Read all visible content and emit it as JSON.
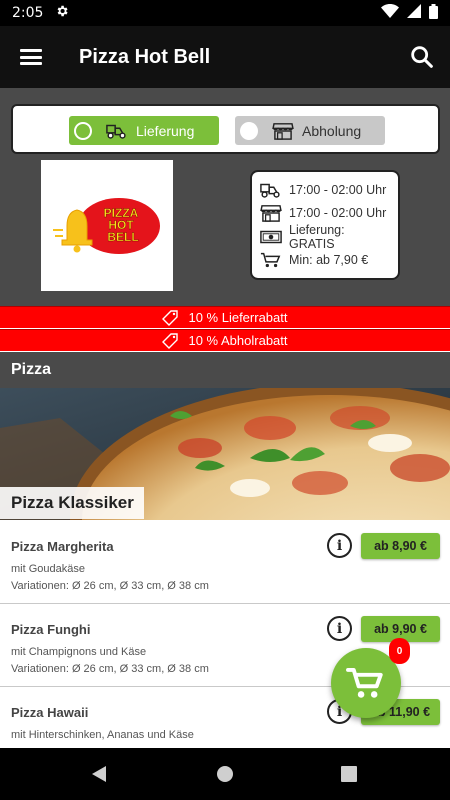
{
  "status_bar": {
    "time": "2:05",
    "icons": [
      "gear-icon",
      "wifi-icon",
      "signal-icon",
      "battery-icon"
    ]
  },
  "app_bar": {
    "title": "Pizza Hot Bell",
    "menu_icon": "hamburger-icon",
    "search_icon": "search-icon"
  },
  "order_type": {
    "delivery_label": "Lieferung",
    "pickup_label": "Abholung",
    "selected": "delivery"
  },
  "restaurant": {
    "logo_text": [
      "PIZZA",
      "HOT",
      "BELL"
    ],
    "hours": [
      {
        "icon": "delivery-scooter-icon",
        "text": "17:00 - 02:00 Uhr"
      },
      {
        "icon": "shop-icon",
        "text": "17:00 - 02:00 Uhr"
      },
      {
        "icon": "money-icon",
        "text": "Lieferung: GRATIS"
      },
      {
        "icon": "cart-icon",
        "text": "Min: ab 7,90 €"
      }
    ]
  },
  "discounts": [
    {
      "text": "10 % Lieferrabatt"
    },
    {
      "text": "10 % Abholrabatt"
    }
  ],
  "category": {
    "title": "Pizza",
    "subcategory": "Pizza Klassiker"
  },
  "products": [
    {
      "name": "Pizza Margherita",
      "description": "mit Goudakäse",
      "variations": "Variationen: Ø 26 cm, Ø 33 cm, Ø 38 cm",
      "price": "ab 8,90 €"
    },
    {
      "name": "Pizza Funghi",
      "description": "mit Champignons und Käse",
      "variations": "Variationen: Ø 26 cm, Ø 33 cm, Ø 38 cm",
      "price": "ab 9,90 €"
    },
    {
      "name": "Pizza Hawaii",
      "description": "mit Hinterschinken, Ananas und Käse",
      "variations": "",
      "price": "ab 11,90 €"
    }
  ],
  "cart": {
    "count": "0"
  },
  "colors": {
    "accent_green": "#7cbf3a",
    "discount_red": "#ff0000",
    "header_gray": "#4a4a4a",
    "app_bar": "#111111"
  }
}
